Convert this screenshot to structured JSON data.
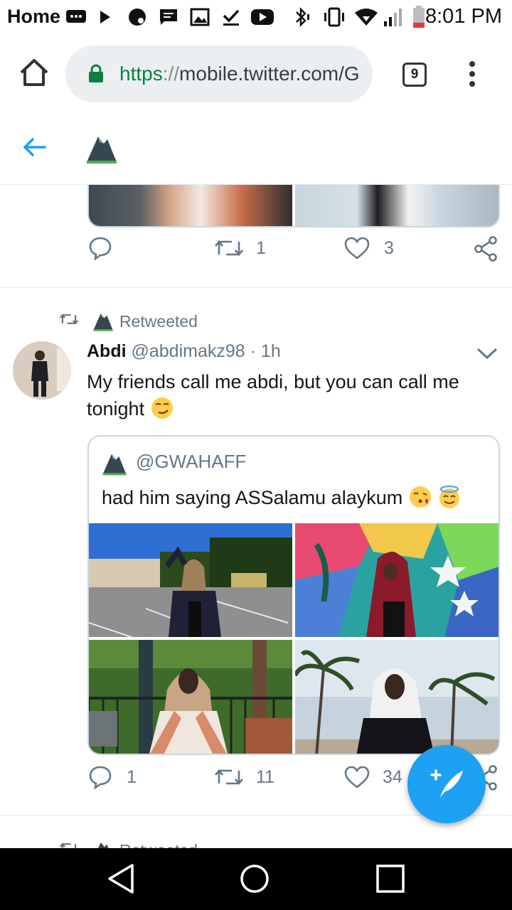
{
  "status_bar": {
    "label": "Home",
    "time": "8:01 PM"
  },
  "browser": {
    "url_scheme": "https",
    "url_sep": "://",
    "url_host": "mobile.twitter.com/G",
    "tab_count": "9"
  },
  "previous_tweet": {
    "retweets": "1",
    "likes": "3"
  },
  "tweet": {
    "retweeted_label": "Retweeted",
    "name": "Abdi",
    "handle": "@abdimakz98",
    "dot": "·",
    "time": "1h",
    "text": "My friends call me abdi, but you can call me tonight",
    "quote": {
      "handle": "@GWAHAFF",
      "text": "had him saying ASSalamu alaykum"
    },
    "replies": "1",
    "retweets": "11",
    "likes": "34"
  },
  "next_tweet": {
    "retweeted_label": "Retweeted"
  },
  "colors": {
    "twitter_blue": "#1da1f2",
    "secure_green": "#0b8043",
    "muted_gray": "#657786"
  },
  "icons": [
    "home-icon",
    "lock-icon",
    "tab-switcher-icon",
    "overflow-menu-icon",
    "back-arrow-icon",
    "reply-icon",
    "retweet-icon",
    "like-icon",
    "share-icon",
    "chevron-down-icon",
    "compose-icon",
    "nav-back-icon",
    "nav-home-icon",
    "nav-recents-icon"
  ]
}
